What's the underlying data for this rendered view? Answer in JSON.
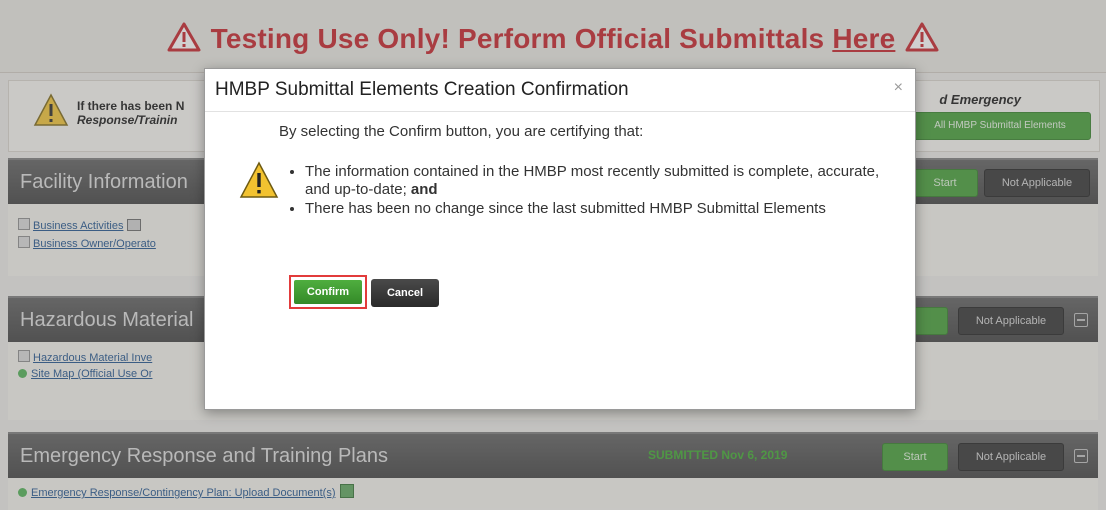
{
  "banner": {
    "title": "Testing Use Only! Perform Official Submittals",
    "link": "Here"
  },
  "notice": {
    "left_line1": "If there has been N",
    "left_line2": "Response/Trainin",
    "right_line1": "d Emergency",
    "button": "All HMBP Submittal Elements"
  },
  "sections": {
    "facility": {
      "title": "Facility Information",
      "start": "Start",
      "not_applicable": "Not Applicable",
      "links": [
        "Business Activities",
        "Business Owner/Operato"
      ]
    },
    "hazmat": {
      "title": "Hazardous Material",
      "not_applicable": "Not Applicable",
      "links": [
        "Hazardous Material Inve",
        "Site Map (Official Use Or"
      ]
    },
    "emergency": {
      "title": "Emergency Response and Training Plans",
      "status": "SUBMITTED Nov 6, 2019",
      "start": "Start",
      "not_applicable": "Not Applicable",
      "links": [
        "Emergency Response/Contingency Plan: Upload Document(s)"
      ]
    }
  },
  "modal": {
    "title": "HMBP Submittal Elements Creation Confirmation",
    "close": "×",
    "intro": "By selecting the Confirm button, you are certifying that:",
    "bullet1_a": "The information contained in the HMBP most recently submitted is complete, accurate, and up-to-date;",
    "bullet1_b": "and",
    "bullet2": "There has been no change since the last submitted HMBP Submittal Elements",
    "confirm": "Confirm",
    "cancel": "Cancel"
  },
  "colors": {
    "banner_red": "#c41c24",
    "accent_green": "#3f9b32",
    "bar_dark": "#3d3d3d",
    "highlight": "#e23b3b"
  }
}
